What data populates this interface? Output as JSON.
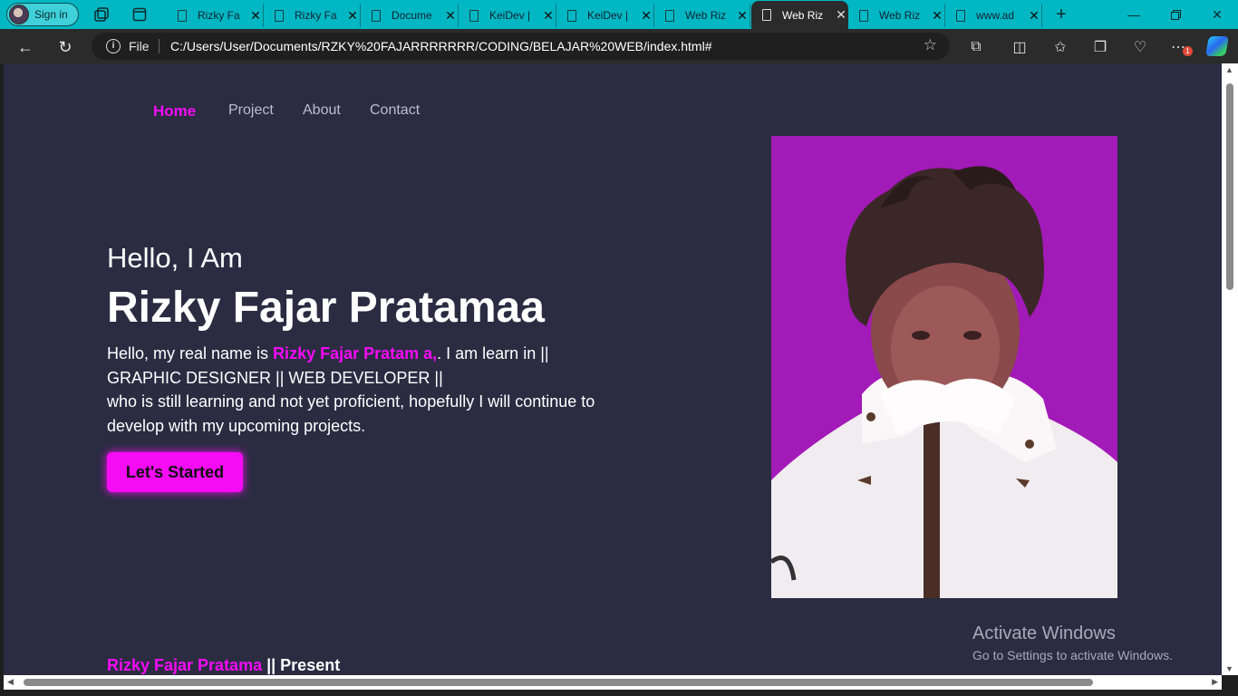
{
  "browser": {
    "signin_label": "Sign in",
    "tabs": [
      {
        "title": "Rizky Fa"
      },
      {
        "title": "Rizky Fa"
      },
      {
        "title": "Docume"
      },
      {
        "title": "KeiDev |"
      },
      {
        "title": "KeiDev |"
      },
      {
        "title": "Web Riz"
      },
      {
        "title": "Web Riz",
        "active": true
      },
      {
        "title": "Web Riz"
      },
      {
        "title": "www.ad"
      }
    ],
    "address": {
      "scheme_label": "File",
      "url": "C:/Users/User/Documents/RZKY%20FAJARRRRRRR/CODING/BELAJAR%20WEB/index.html#"
    },
    "notification_count": "1"
  },
  "page": {
    "nav": [
      {
        "label": "Home",
        "active": true
      },
      {
        "label": "Project"
      },
      {
        "label": "About"
      },
      {
        "label": "Contact"
      }
    ],
    "greeting": "Hello, I Am",
    "name": "Rizky Fajar Pratamaa",
    "description": {
      "part1": "Hello, my real name is ",
      "highlight": "Rizky Fajar Pratam a,",
      "part2": ". I am learn in || GRAPHIC DESIGNER || WEB DEVELOPER ||",
      "part3": "who is still learning and not yet proficient, hopefully I will continue to develop with my upcoming projects."
    },
    "cta_label": "Let's Started",
    "accent_color": "#f50cf5",
    "background_color": "#2b2c42",
    "photo_background": "#a21ab7",
    "footer": {
      "name": "Rizky Fajar Pratama",
      "suffix": " || Present"
    }
  },
  "os_overlay": {
    "title": "Activate Windows",
    "subtitle": "Go to Settings to activate Windows."
  }
}
